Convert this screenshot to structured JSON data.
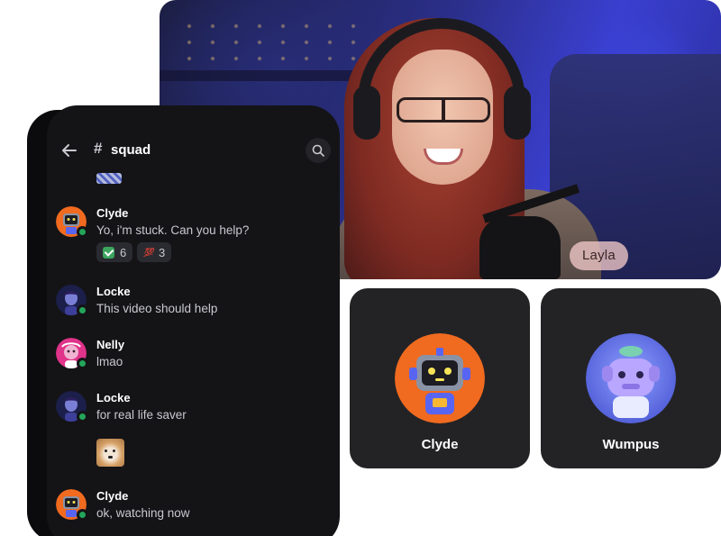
{
  "channel": {
    "name": "squad",
    "back_icon": "arrow-left-icon",
    "search_icon": "search-icon"
  },
  "messages": [
    {
      "author": "Clyde",
      "text": "Yo, i'm stuck. Can you help?",
      "avatar": "clyde-robot-avatar",
      "reactions": [
        {
          "emoji": "check-mark-icon",
          "count": "6"
        },
        {
          "emoji": "hundred-points-icon",
          "count": "3"
        }
      ]
    },
    {
      "author": "Locke",
      "text": "This video should help",
      "avatar": "locke-avatar"
    },
    {
      "author": "Nelly",
      "text": "lmao",
      "avatar": "nelly-avatar"
    },
    {
      "author": "Locke",
      "text": "for real life saver",
      "avatar": "locke-avatar"
    },
    {
      "author": "Clyde",
      "text": "ok, watching now",
      "avatar": "clyde-robot-avatar"
    }
  ],
  "video": {
    "participant_name": "Layla"
  },
  "participants": [
    {
      "name": "Clyde",
      "avatar": "clyde-robot-avatar"
    },
    {
      "name": "Wumpus",
      "avatar": "wumpus-avatar"
    }
  ],
  "colors": {
    "status_online": "#23a55a",
    "panel_bg": "#141417",
    "tile_bg": "#232326"
  }
}
